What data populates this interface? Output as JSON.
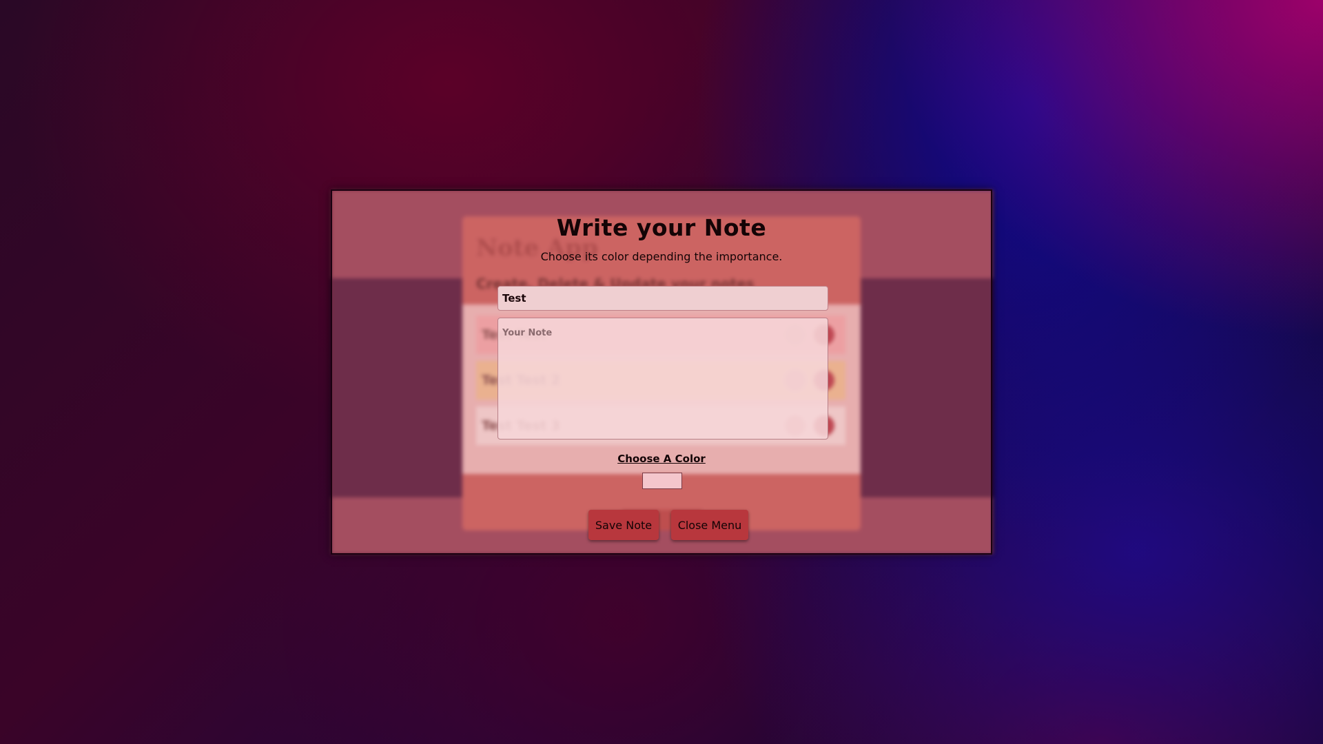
{
  "background_app": {
    "title": "Note App",
    "subtitle": "Create, Delete & Update your notes",
    "notes": [
      {
        "text": "Test Test",
        "color": "#f4b2b6"
      },
      {
        "text": "Test Test 2",
        "color": "#f0cc9a"
      },
      {
        "text": "Test Test 3",
        "color": "#f6eaea"
      }
    ]
  },
  "modal": {
    "title": "Write your Note",
    "subtitle": "Choose its color depending the importance.",
    "title_input": {
      "value": "Test",
      "placeholder": ""
    },
    "note_textarea": {
      "value": "",
      "placeholder": "Your Note"
    },
    "color_label": "Choose A Color",
    "selected_color": "#f4c6cc",
    "save_button": "Save Note",
    "close_button": "Close Menu"
  },
  "colors": {
    "accent": "#b8373d",
    "modal_tint": "#dc7878"
  }
}
